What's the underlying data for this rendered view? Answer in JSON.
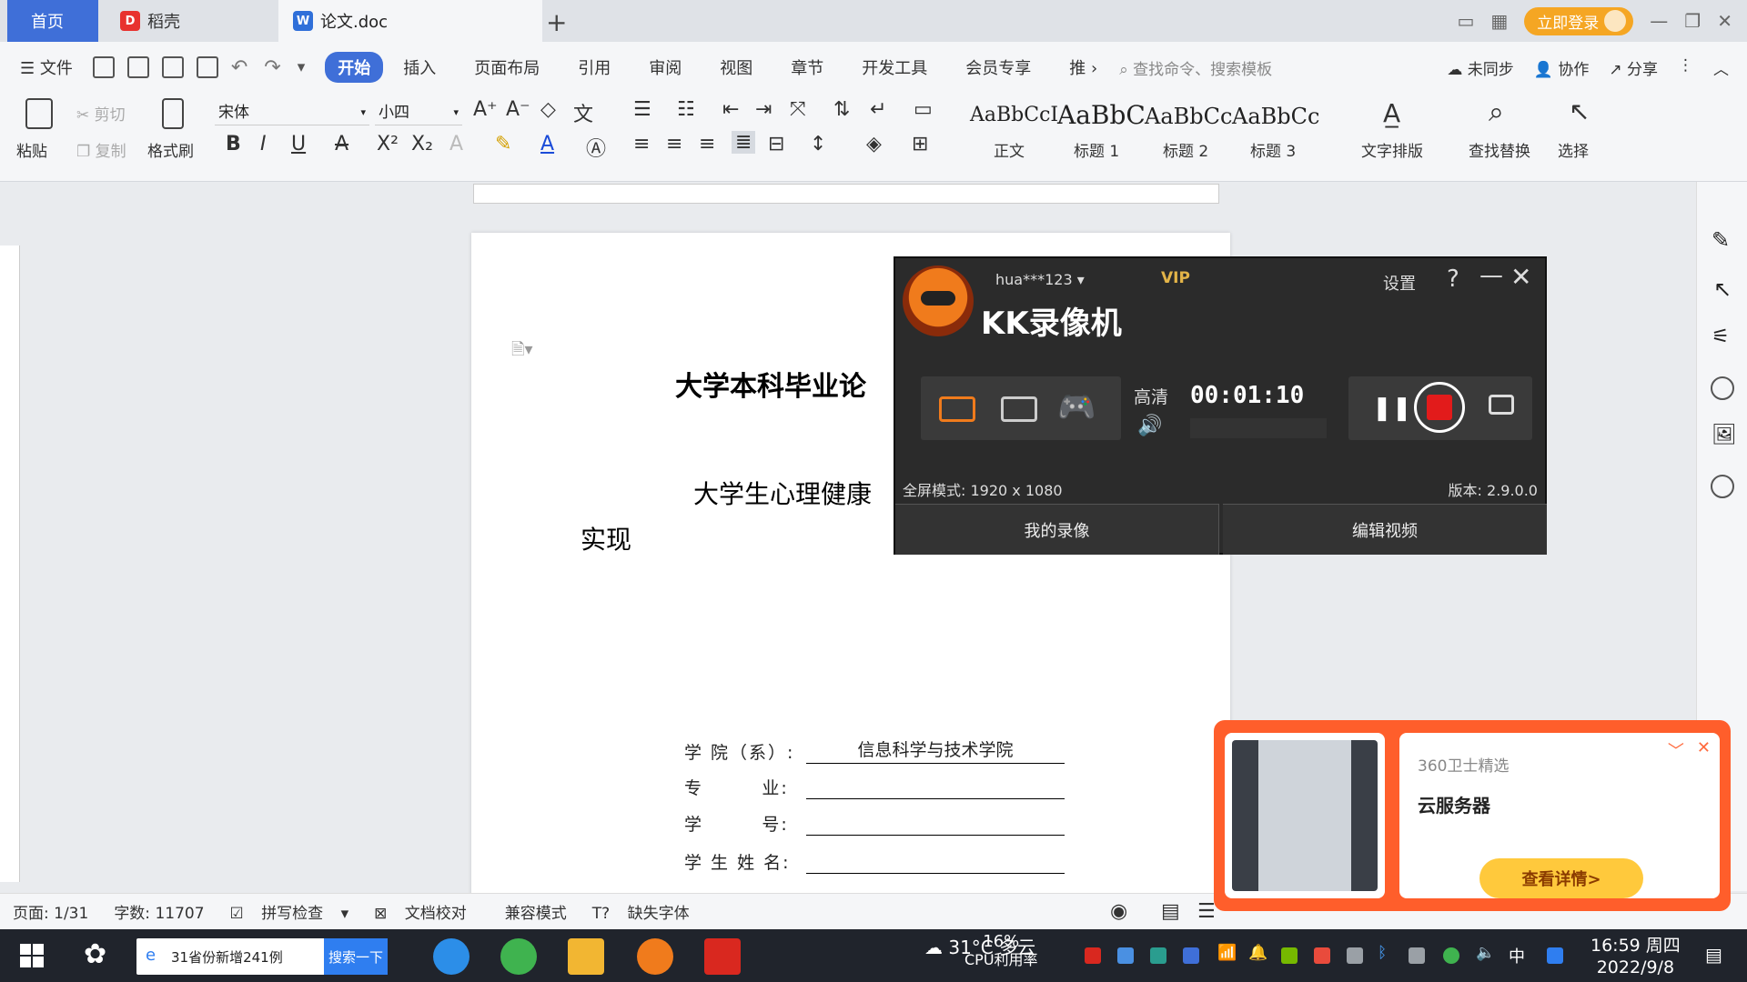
{
  "tabs": {
    "home": "首页",
    "daoke": "稻壳",
    "doc": "论文.doc"
  },
  "header": {
    "login": "立即登录"
  },
  "menu": {
    "file": "文件",
    "items": [
      "开始",
      "插入",
      "页面布局",
      "引用",
      "审阅",
      "视图",
      "章节",
      "开发工具",
      "会员专享",
      "推"
    ],
    "search_placeholder": "查找命令、搜索模板",
    "sync": "未同步",
    "collab": "协作",
    "share": "分享"
  },
  "ribbon": {
    "paste": "粘贴",
    "cut": "剪切",
    "copy": "复制",
    "format_painter": "格式刷",
    "font_name": "宋体",
    "font_size": "小四",
    "styles": [
      {
        "preview": "AaBbCcI",
        "label": "正文"
      },
      {
        "preview": "AaBbC",
        "label": "标题 1"
      },
      {
        "preview": "AaBbCc",
        "label": "标题 2"
      },
      {
        "preview": "AaBbCc",
        "label": "标题 3"
      }
    ],
    "text_layout": "文字排版",
    "find_replace": "查找替换",
    "select": "选择"
  },
  "document": {
    "title": "大学本科毕业论",
    "subtitle_line1": "大学生心理健康",
    "subtitle_line2": "实现",
    "form": [
      {
        "label": "学 院（系）:",
        "value": "信息科学与技术学院"
      },
      {
        "label": "专        业:",
        "value": ""
      },
      {
        "label": "学        号:",
        "value": ""
      },
      {
        "label": "学 生 姓 名:",
        "value": ""
      }
    ]
  },
  "statusbar": {
    "page": "页面: 1/31",
    "words": "字数: 11707",
    "spell": "拼写检查",
    "proof": "文档校对",
    "compat": "兼容模式",
    "missing_font": "缺失字体"
  },
  "kk_recorder": {
    "user": "hua***123",
    "vip": "VIP",
    "title": "KK录像机",
    "settings": "设置",
    "help": "?",
    "quality": "高清",
    "time": "00:01:10",
    "mode": "全屏模式: 1920 x 1080",
    "version": "版本: 2.9.0.0",
    "my_recordings": "我的录像",
    "edit_video": "编辑视频"
  },
  "ad": {
    "source": "360卫士精选",
    "title": "云服务器",
    "button": "查看详情>"
  },
  "taskbar": {
    "search_text": "31省份新增241例",
    "search_button": "搜索一下",
    "weather": "31°C 多云",
    "cpu": "16%",
    "cpu_label": "CPU利用率",
    "ime": "中",
    "time": "16:59 周四",
    "date": "2022/9/8"
  }
}
